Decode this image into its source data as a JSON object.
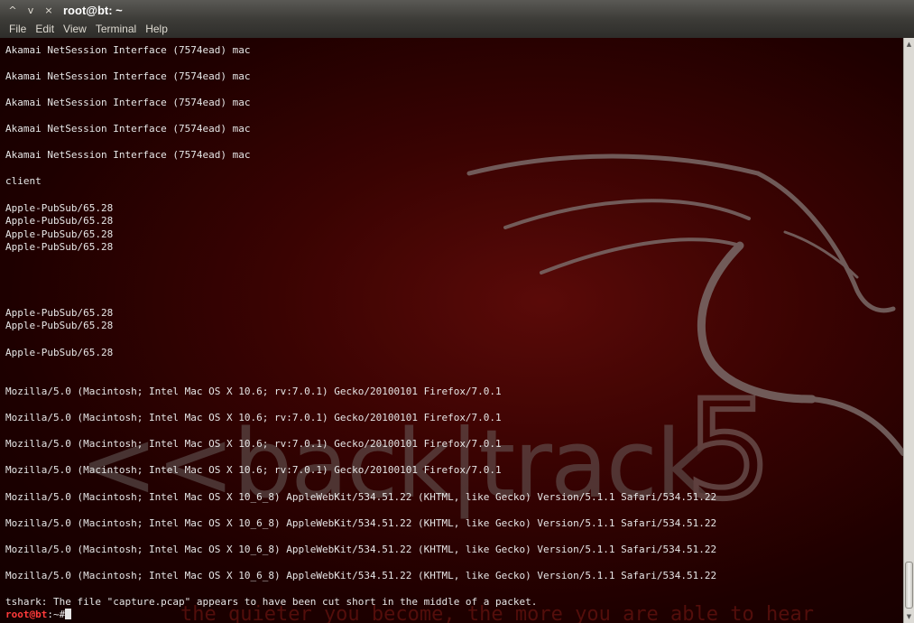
{
  "window": {
    "title": "root@bt: ~",
    "controls": [
      {
        "name": "minimize-window-button",
        "glyph": "^"
      },
      {
        "name": "maximize-window-button",
        "glyph": "v"
      },
      {
        "name": "close-window-button",
        "glyph": "×"
      }
    ]
  },
  "menubar": {
    "items": [
      "File",
      "Edit",
      "View",
      "Terminal",
      "Help"
    ]
  },
  "background": {
    "logo_text": "<<back|track",
    "logo_number": "5",
    "tagline": "the quieter you become, the more you are able to hear"
  },
  "terminal": {
    "lines": [
      "Akamai NetSession Interface (7574ead) mac",
      "",
      "Akamai NetSession Interface (7574ead) mac",
      "",
      "Akamai NetSession Interface (7574ead) mac",
      "",
      "Akamai NetSession Interface (7574ead) mac",
      "",
      "Akamai NetSession Interface (7574ead) mac",
      "",
      "client",
      "",
      "Apple-PubSub/65.28",
      "Apple-PubSub/65.28",
      "Apple-PubSub/65.28",
      "Apple-PubSub/65.28",
      "",
      "",
      "",
      "",
      "Apple-PubSub/65.28",
      "Apple-PubSub/65.28",
      "",
      "Apple-PubSub/65.28",
      "",
      "",
      "Mozilla/5.0 (Macintosh; Intel Mac OS X 10.6; rv:7.0.1) Gecko/20100101 Firefox/7.0.1",
      "",
      "Mozilla/5.0 (Macintosh; Intel Mac OS X 10.6; rv:7.0.1) Gecko/20100101 Firefox/7.0.1",
      "",
      "Mozilla/5.0 (Macintosh; Intel Mac OS X 10.6; rv:7.0.1) Gecko/20100101 Firefox/7.0.1",
      "",
      "Mozilla/5.0 (Macintosh; Intel Mac OS X 10.6; rv:7.0.1) Gecko/20100101 Firefox/7.0.1",
      "",
      "Mozilla/5.0 (Macintosh; Intel Mac OS X 10_6_8) AppleWebKit/534.51.22 (KHTML, like Gecko) Version/5.1.1 Safari/534.51.22",
      "",
      "Mozilla/5.0 (Macintosh; Intel Mac OS X 10_6_8) AppleWebKit/534.51.22 (KHTML, like Gecko) Version/5.1.1 Safari/534.51.22",
      "",
      "Mozilla/5.0 (Macintosh; Intel Mac OS X 10_6_8) AppleWebKit/534.51.22 (KHTML, like Gecko) Version/5.1.1 Safari/534.51.22",
      "",
      "Mozilla/5.0 (Macintosh; Intel Mac OS X 10_6_8) AppleWebKit/534.51.22 (KHTML, like Gecko) Version/5.1.1 Safari/534.51.22",
      "",
      "tshark: The file \"capture.pcap\" appears to have been cut short in the middle of a packet."
    ],
    "prompt_user": "root@bt",
    "prompt_rest": ":~#"
  },
  "colors": {
    "background": "#1b0000",
    "text": "#e6e6e6",
    "prompt": "#ff3b3b",
    "titlebar": "#3c3b37"
  }
}
